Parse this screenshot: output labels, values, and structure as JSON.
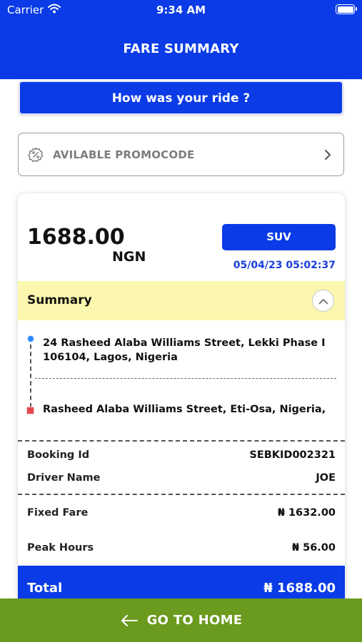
{
  "status_bar": {
    "carrier": "Carrier",
    "time": "9:34 AM"
  },
  "header": {
    "title": "FARE SUMMARY"
  },
  "ride_feedback_button": "How was your ride ?",
  "promo": {
    "label": "AVILABLE PROMOCODE",
    "icon": "percent-badge-icon"
  },
  "fare": {
    "amount": "1688.00",
    "currency": "NGN",
    "vehicle": "SUV",
    "datetime": "05/04/23 05:02:37"
  },
  "summary": {
    "title": "Summary",
    "pickup": "24 Rasheed Alaba Williams Street, Lekki Phase I 106104, Lagos, Nigeria",
    "dropoff": "Rasheed Alaba Williams Street, Eti-Osa, Nigeria,",
    "rows": [
      {
        "label": "Booking Id",
        "value": "SEBKID002321"
      },
      {
        "label": "Driver Name",
        "value": "JOE"
      },
      {
        "label": "Fixed Fare",
        "value": "₦ 1632.00"
      },
      {
        "label": "Peak Hours",
        "value": "₦ 56.00"
      }
    ],
    "total_label": "Total",
    "total_value": "₦ 1688.00"
  },
  "footer": {
    "home_label": "GO TO HOME"
  },
  "colors": {
    "primary": "#0a3be6",
    "summary_bg": "#fbf7ae",
    "footer_bg": "#6a9a1e",
    "date_text": "#1a3fd8"
  }
}
